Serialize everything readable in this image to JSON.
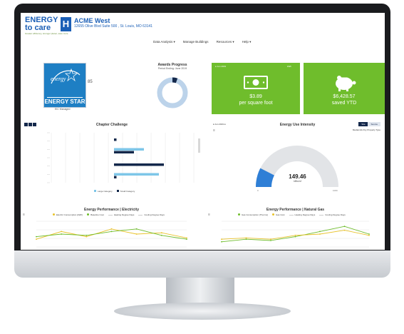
{
  "brand": {
    "line1": "ENERGY",
    "line2": "to care",
    "h_letter": "H",
    "tagline": "Greater efficiency, stronger planet, save more"
  },
  "account": {
    "name": "ACME West",
    "address": "12655 Olive Blvd Suite 500 , St. Louis, MO 63141"
  },
  "nav": {
    "items": [
      "Data Analysis ▾",
      "Manage Buildings",
      "Resources ▾",
      "Help ▾"
    ]
  },
  "energy_star": {
    "logo_script": "energy",
    "logo_word": "ENERGY STAR",
    "score": "85",
    "label": "EIC Managed"
  },
  "awards": {
    "title": "Awards Progress",
    "subtitle": "Period Ending: June 2019"
  },
  "cost_card": {
    "period": "● Jun 2019",
    "toggle": "kWh",
    "value": "$3.89",
    "caption": "per square foot"
  },
  "savings_card": {
    "value": "$6,428.57",
    "caption": "saved YTD"
  },
  "chapter": {
    "title": "Chapter Challenge",
    "legend": [
      "Large Category",
      "Small Category"
    ]
  },
  "eui": {
    "title": "Energy Use Intensity",
    "period": "● Jun 2019 ●",
    "tabs": [
      "Site",
      "Source"
    ],
    "subtitle": "Median EUI by Property Type",
    "value": "149.46",
    "unit": "kBtu/sf",
    "min_label": "0",
    "max_label": "1000",
    "gauge_fraction": 0.15
  },
  "electricity": {
    "title": "Energy Performance | Electricity",
    "legend": [
      "Electric Consumption (kWh)",
      "Baseline Cost",
      "Heating Degree Days",
      "Cooling Degree Days"
    ]
  },
  "gas": {
    "title": "Energy Performance | Natural Gas",
    "legend": [
      "Gas Consumption (Therms)",
      "Gas Cost",
      "Heating Degree Days",
      "Cooling Degree Days"
    ]
  },
  "colors": {
    "brand_blue": "#1b5fb6",
    "green": "#6fbd2c",
    "navy": "#14284b",
    "light_blue": "#7ec6e8",
    "gauge_blue": "#2f7fd6",
    "gold": "#e8c22a"
  },
  "chart_data": [
    {
      "type": "bar",
      "title": "Chapter Challenge",
      "series": [
        {
          "name": "Large Category",
          "values": [
            0,
            0.6,
            0,
            0.9
          ]
        },
        {
          "name": "Small Category",
          "values": [
            0.05,
            0.4,
            1.0,
            0.05
          ]
        }
      ]
    },
    {
      "type": "line",
      "title": "Energy Performance | Electricity",
      "series": [
        {
          "name": "Electric Consumption (kWh)",
          "values": [
            0.3,
            0.6,
            0.4,
            0.7,
            0.5,
            0.55,
            0.35
          ]
        },
        {
          "name": "Baseline Cost",
          "values": [
            0.4,
            0.5,
            0.45,
            0.6,
            0.7,
            0.45,
            0.3
          ]
        }
      ]
    },
    {
      "type": "line",
      "title": "Energy Performance | Natural Gas",
      "series": [
        {
          "name": "Gas Consumption (Therms)",
          "values": [
            0.2,
            0.3,
            0.25,
            0.4,
            0.6,
            0.8,
            0.5
          ]
        },
        {
          "name": "Gas Cost",
          "values": [
            0.3,
            0.35,
            0.3,
            0.45,
            0.5,
            0.65,
            0.45
          ]
        }
      ]
    }
  ]
}
